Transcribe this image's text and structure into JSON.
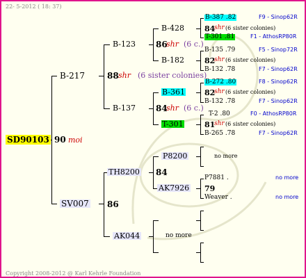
{
  "header": {
    "date": "22- 5-2012 ( 18: 37)"
  },
  "footer": {
    "copyright": "Copyright 2008-2012 @ Karl Kehrle Foundation"
  },
  "subject": {
    "ring": "SD90103",
    "year": "90",
    "breeder": "moi"
  },
  "sire": {
    "ring": "B-217",
    "year": "88",
    "breeder": "shr",
    "note": "(6 sister colonies)"
  },
  "dam": {
    "ring": "SV007",
    "year": "86"
  },
  "gen2": [
    {
      "ring": "B-123",
      "year": "86",
      "breeder": "shr",
      "note": "(6 c.)"
    },
    {
      "ring": "B-137",
      "year": "84",
      "breeder": "shr",
      "note": "(6 c.)"
    },
    {
      "ring": "TH8200",
      "year": "84"
    },
    {
      "ring": "AK044"
    }
  ],
  "gen3": [
    {
      "ring": "B-428",
      "year": "84",
      "breeder": "shr",
      "note": "(6 sister colonies)"
    },
    {
      "ring": "B-182",
      "year": "82",
      "breeder": "shr",
      "note": "(6 sister colonies)"
    },
    {
      "ring": "B-361",
      "year": "82",
      "breeder": "shr",
      "note": "(6 sister colonies)"
    },
    {
      "ring": "T-301",
      "year": "81",
      "breeder": "shr",
      "note": "(6 sister colonies)"
    },
    {
      "ring": "P8200"
    },
    {
      "ring": "AK7926",
      "year": "79"
    },
    {
      "note": "no more"
    }
  ],
  "gen4": [
    {
      "ring": "B-387 .82",
      "line": "F9 - Sinop62R"
    },
    {
      "ring": "T-301 .81",
      "line": "F1 - AthosRP80R"
    },
    {
      "ring": "B-135 .79",
      "line": "F5 - Sinop72R"
    },
    {
      "ring": "B-132 .78",
      "line": "F7 - Sinop62R"
    },
    {
      "ring": "B-272 .80",
      "line": "F8 - Sinop62R"
    },
    {
      "ring": "B-132 .78",
      "line": "F7 - Sinop62R"
    },
    {
      "ring": "T-2 .80",
      "line": "F0 - AthosRP80R"
    },
    {
      "ring": "B-265 .78",
      "line": "F7 - Sinop62R"
    },
    {
      "note": "no more"
    },
    {
      "ring": "P7881 .",
      "note": "no more"
    },
    {
      "ring": "Weaver .",
      "note": "no more"
    }
  ]
}
